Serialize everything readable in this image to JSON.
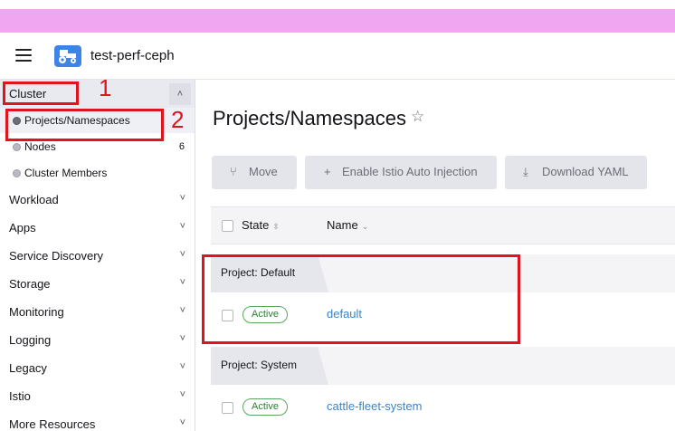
{
  "colors": {
    "top_bar": "#f1a6f2",
    "logo": "#3d84e6",
    "annotation": "#e0141c",
    "active_badge": "#2e7d32",
    "link": "#3d84c6"
  },
  "header": {
    "cluster_name": "test-perf-ceph",
    "menu_icon": "hamburger-icon",
    "logo_icon": "tractor-icon"
  },
  "sidebar": {
    "group": {
      "label": "Cluster",
      "toggle": "˄"
    },
    "subitems": [
      {
        "label": "Projects/Namespaces",
        "count": ""
      },
      {
        "label": "Nodes",
        "count": "6"
      },
      {
        "label": "Cluster Members",
        "count": ""
      }
    ],
    "nav": [
      {
        "label": "Workload",
        "chevron": "˅"
      },
      {
        "label": "Apps",
        "chevron": "˅"
      },
      {
        "label": "Service Discovery",
        "chevron": "˅"
      },
      {
        "label": "Storage",
        "chevron": "˅"
      },
      {
        "label": "Monitoring",
        "chevron": "˅"
      },
      {
        "label": "Logging",
        "chevron": "˅"
      },
      {
        "label": "Legacy",
        "chevron": "˅"
      },
      {
        "label": "Istio",
        "chevron": "˅"
      },
      {
        "label": "More Resources",
        "chevron": "˅"
      }
    ]
  },
  "main": {
    "title": "Projects/Namespaces",
    "star": "☆",
    "buttons": [
      {
        "label": "Move",
        "icon": "⑂"
      },
      {
        "label": "Enable Istio Auto Injection",
        "icon": "+"
      },
      {
        "label": "Download YAML",
        "icon": "⤓"
      }
    ],
    "table": {
      "columns": [
        {
          "label": "State",
          "sort": "⇳"
        },
        {
          "label": "Name",
          "sort": "⌄"
        }
      ],
      "groups": [
        {
          "label": "Project: Default",
          "rows": [
            {
              "state": "Active",
              "name": "default"
            }
          ]
        },
        {
          "label": "Project: System",
          "rows": [
            {
              "state": "Active",
              "name": "cattle-fleet-system"
            }
          ]
        }
      ]
    }
  },
  "annotations": [
    "1",
    "2"
  ]
}
